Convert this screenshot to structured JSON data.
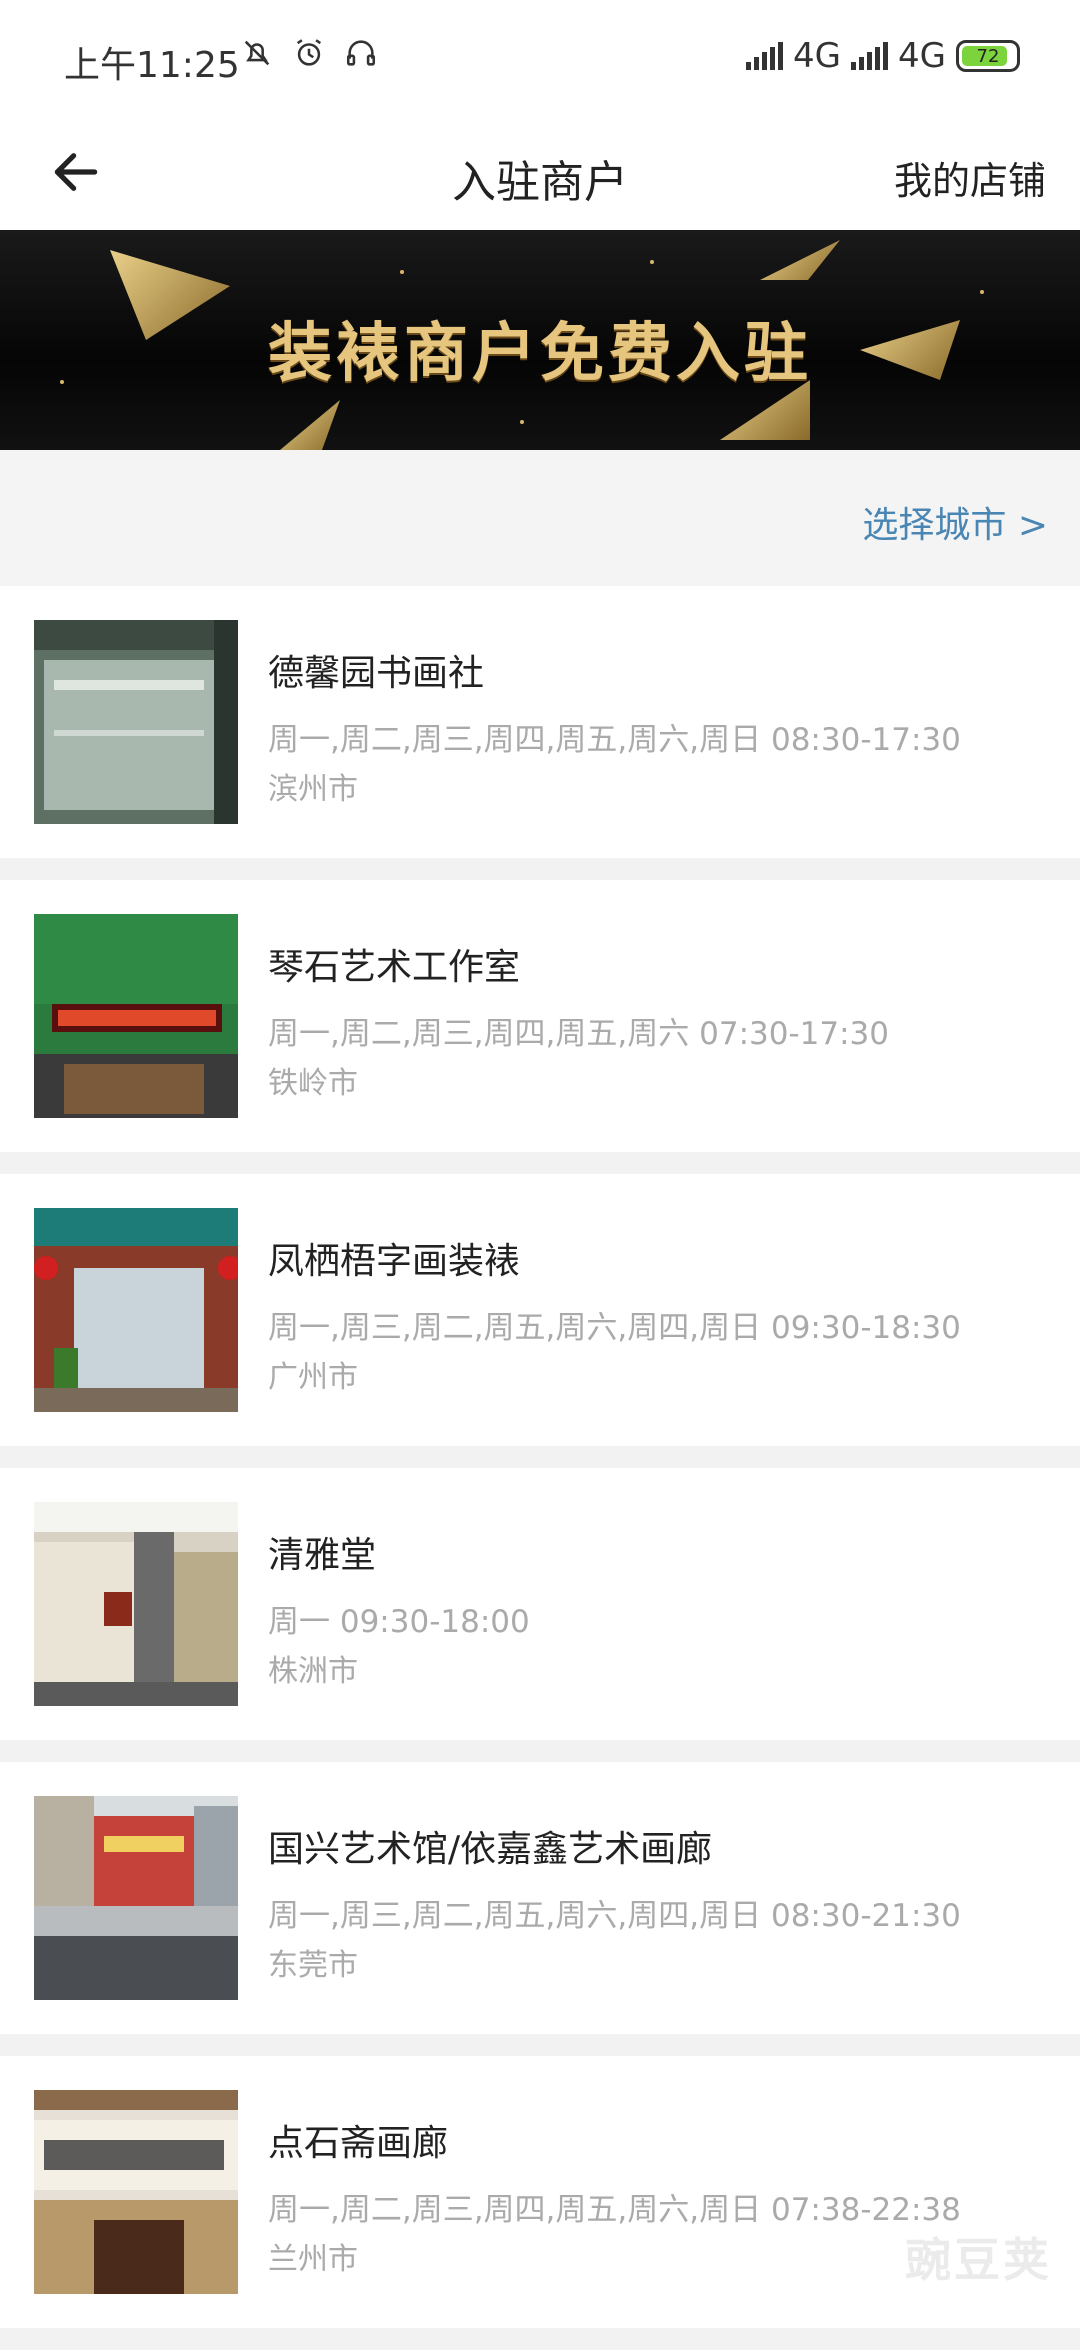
{
  "status_bar": {
    "time": "上午11:25",
    "network1": "4G",
    "network2": "4G",
    "battery": "72"
  },
  "header": {
    "title": "入驻商户",
    "right_link": "我的店铺"
  },
  "banner": {
    "text": "装裱商户免费入驻"
  },
  "city_selector": {
    "label": "选择城市 >"
  },
  "merchants": [
    {
      "name": "德馨园书画社",
      "hours": "周一,周二,周三,周四,周五,周六,周日 08:30-17:30",
      "city": "滨州市"
    },
    {
      "name": "琴石艺术工作室",
      "hours": "周一,周二,周三,周四,周五,周六 07:30-17:30",
      "city": "铁岭市"
    },
    {
      "name": "凤栖梧字画装裱",
      "hours": "周一,周三,周二,周五,周六,周四,周日 09:30-18:30",
      "city": "广州市"
    },
    {
      "name": "清雅堂",
      "hours": "周一 09:30-18:00",
      "city": "株洲市"
    },
    {
      "name": "国兴艺术馆/依嘉鑫艺术画廊",
      "hours": "周一,周三,周二,周五,周六,周四,周日 08:30-21:30",
      "city": "东莞市"
    },
    {
      "name": "点石斋画廊",
      "hours": "周一,周二,周三,周四,周五,周六,周日 07:38-22:38",
      "city": "兰州市"
    }
  ],
  "watermark": "豌豆荚",
  "colors": {
    "link": "#4a86b4",
    "muted": "#aaaaaa",
    "gold": "#e6c57e"
  }
}
